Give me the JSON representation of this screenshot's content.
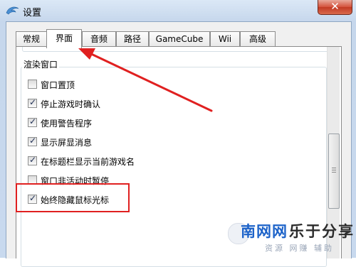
{
  "window": {
    "title": "设置",
    "close_label": "✕"
  },
  "tabs": [
    {
      "label": "常规",
      "active": false
    },
    {
      "label": "界面",
      "active": true
    },
    {
      "label": "音频",
      "active": false
    },
    {
      "label": "路径",
      "active": false
    },
    {
      "label": "GameCube",
      "active": false
    },
    {
      "label": "Wii",
      "active": false
    },
    {
      "label": "高级",
      "active": false
    }
  ],
  "render_window": {
    "group_title": "渲染窗口",
    "options": [
      {
        "label": "窗口置顶",
        "checked": false
      },
      {
        "label": "停止游戏时确认",
        "checked": true
      },
      {
        "label": "使用警告程序",
        "checked": true
      },
      {
        "label": "显示屏显消息",
        "checked": true
      },
      {
        "label": "在标题栏显示当前游戏名",
        "checked": true
      },
      {
        "label": "窗口非活动时暂停",
        "checked": false
      },
      {
        "label": "始终隐藏鼠标光标",
        "checked": true
      }
    ]
  },
  "watermark": {
    "brand_part1": "南网网",
    "brand_part2": "乐于分享",
    "tagline": "资源 网赚 辅助"
  },
  "colors": {
    "annotation_red": "#e02020",
    "watermark_blue": "#1d63c9"
  }
}
